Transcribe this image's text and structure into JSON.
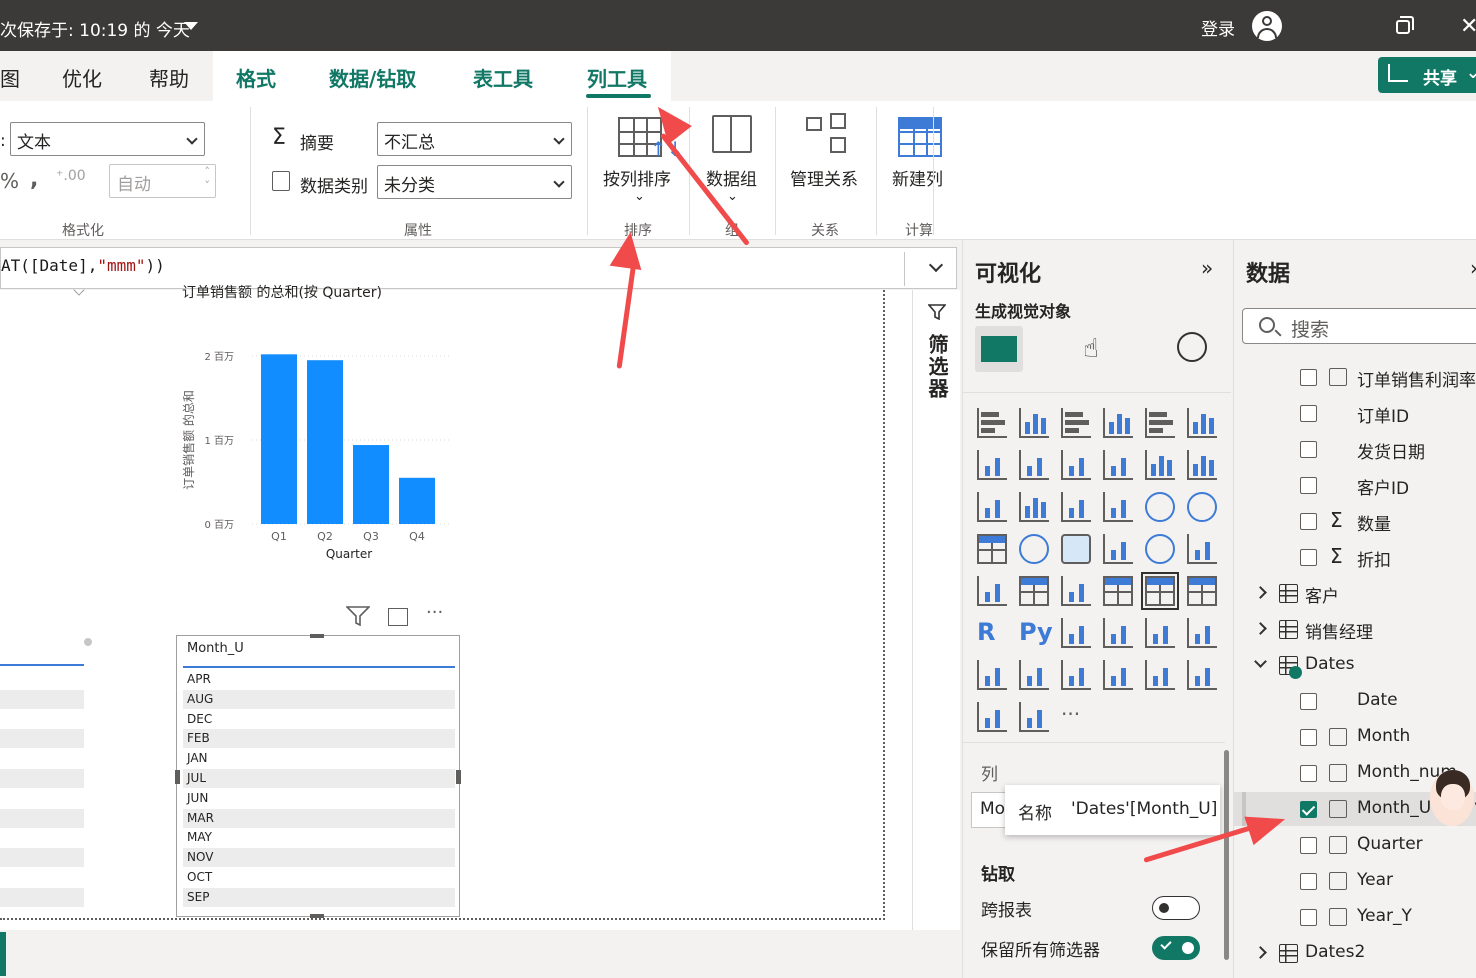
{
  "titlebar": {
    "save_status": "次保存于: 10:19 的 今天",
    "login": "登录"
  },
  "tabs": [
    {
      "label": "图",
      "style": "plain"
    },
    {
      "label": "优化",
      "style": "plain"
    },
    {
      "label": "帮助",
      "style": "plain"
    },
    {
      "label": "格式",
      "style": "green"
    },
    {
      "label": "数据/钻取",
      "style": "green"
    },
    {
      "label": "表工具",
      "style": "green"
    },
    {
      "label": "列工具",
      "style": "green-active"
    }
  ],
  "share": {
    "label": "共享"
  },
  "ribbon": {
    "format": {
      "format_select": "文本",
      "auto_placeholder": "自动",
      "group_label": "格式化"
    },
    "properties": {
      "summary_label": "摘要",
      "summary_value": "不汇总",
      "category_label": "数据类别",
      "category_value": "未分类",
      "group_label": "属性"
    },
    "sort": {
      "button": "按列排序",
      "group_label": "排序"
    },
    "groups": {
      "button": "数据组",
      "group_label": "组"
    },
    "relationships": {
      "button": "管理关系",
      "group_label": "关系"
    },
    "calculations": {
      "button": "新建列",
      "group_label": "计算"
    }
  },
  "formula": {
    "prefix": "AT([Date],",
    "string": "\"mmm\"",
    "suffix": "))"
  },
  "chart_data": {
    "type": "bar",
    "title": "订单销售额 的总和(按 Quarter)",
    "xlabel": "Quarter",
    "ylabel": "订单销售额 的总和",
    "categories": [
      "Q1",
      "Q2",
      "Q3",
      "Q4"
    ],
    "values": [
      2.02,
      1.95,
      0.94,
      0.55
    ],
    "unit": "百万",
    "yticks": [
      "0 百万",
      "1 百万",
      "2 百万"
    ],
    "ylim": [
      0,
      2
    ],
    "color": "#118dff"
  },
  "slicer": {
    "header": "Month_U",
    "items": [
      "APR",
      "AUG",
      "DEC",
      "FEB",
      "JAN",
      "JUL",
      "JUN",
      "MAR",
      "MAY",
      "NOV",
      "OCT",
      "SEP"
    ]
  },
  "filter_pane": {
    "label": "筛选器"
  },
  "viz_pane": {
    "title": "可视化",
    "subtitle": "生成视觉对象",
    "columns_label": "列",
    "column_field": "Mo",
    "drill_title": "钻取",
    "cross_report": "跨报表",
    "keep_filters": "保留所有筛选器",
    "more": "···"
  },
  "tooltip": {
    "key": "名称",
    "value": "'Dates'[Month_U]"
  },
  "data_pane": {
    "title": "数据",
    "search_placeholder": "搜索",
    "fields": [
      {
        "label": "订单销售利润率",
        "icon": "calc-icon",
        "checked": false
      },
      {
        "label": "订单ID",
        "icon": "none",
        "checked": false
      },
      {
        "label": "发货日期",
        "icon": "none",
        "checked": false
      },
      {
        "label": "客户ID",
        "icon": "none",
        "checked": false
      },
      {
        "label": "数量",
        "icon": "sigma-icon",
        "checked": false
      },
      {
        "label": "折扣",
        "icon": "sigma-icon",
        "checked": false
      }
    ],
    "tables": [
      {
        "label": "客户",
        "expanded": false
      },
      {
        "label": "销售经理",
        "expanded": false
      },
      {
        "label": "Dates",
        "expanded": true
      }
    ],
    "dates_fields": [
      {
        "label": "Date",
        "icon": "none",
        "checked": false
      },
      {
        "label": "Month",
        "icon": "calc-column-icon",
        "checked": false
      },
      {
        "label": "Month_num",
        "icon": "calc-icon",
        "checked": false
      },
      {
        "label": "Month_U",
        "icon": "calc-column-icon",
        "checked": true
      },
      {
        "label": "Quarter",
        "icon": "calc-column-icon",
        "checked": false
      },
      {
        "label": "Year",
        "icon": "calc-icon",
        "checked": false
      },
      {
        "label": "Year_Y",
        "icon": "calc-column-icon",
        "checked": false
      }
    ],
    "last_table": "Dates2"
  }
}
